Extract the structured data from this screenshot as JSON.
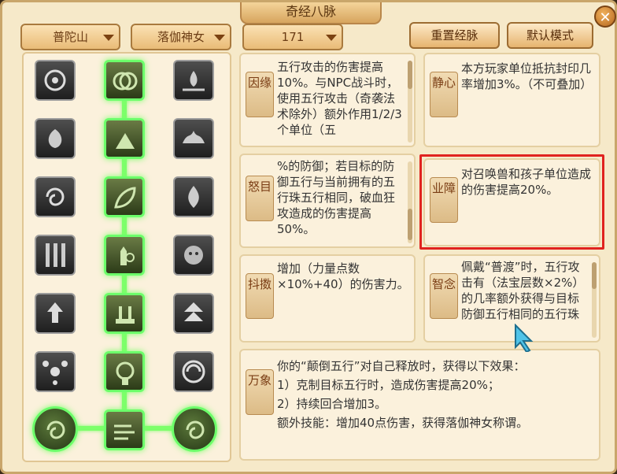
{
  "window": {
    "title": "奇经八脉",
    "close_icon": "close-icon"
  },
  "toolbar": {
    "school": "普陀山",
    "faction": "落伽神女",
    "level": "171",
    "reset_label": "重置经脉",
    "default_label": "默认模式"
  },
  "tree": {
    "left_icons": [
      "lotus-icon",
      "lotus-bud-icon",
      "swirl-icon",
      "bamboo-icon",
      "arrow-up-icon",
      "molecule-icon"
    ],
    "center_icons": [
      "rings-icon",
      "pouring-icon",
      "leaf-icon",
      "hand-sign-icon",
      "temple-icon",
      "bodhisattva-icon"
    ],
    "right_icons": [
      "water-lotus-icon",
      "blooming-lotus-icon",
      "flame-icon",
      "lion-icon",
      "double-arrow-icon",
      "vortex-icon"
    ],
    "bottom_nodes": [
      "spiral-node-left-icon",
      "wind-node-center-icon",
      "spiral-node-right-icon"
    ]
  },
  "cards": {
    "yinyuan": {
      "label": "因缘",
      "text": "五行攻击的伤害提高10%。与NPC战斗时，使用五行攻击（奇袭法术除外）额外作用1/2/3个单位（五"
    },
    "jingxin": {
      "label": "静心",
      "text": "本方玩家单位抵抗封印几率增加3%。（不可叠加）"
    },
    "numu": {
      "label": "怒目",
      "text": "%的防御；若目标的防御五行与当前拥有的五行珠五行相同，破血狂攻造成的伤害提高50%。"
    },
    "yezhang": {
      "label": "业障",
      "text": "对召唤兽和孩子单位造成的伤害提高20%。"
    },
    "dousou": {
      "label": "抖擞",
      "text": "增加（力量点数×10%+40）的伤害力。"
    },
    "zhinian": {
      "label": "智念",
      "text": "佩戴“普渡”时，五行攻击有（法宝层数×2%）的几率额外获得与目标防御五行相同的五行珠"
    },
    "wanxiang": {
      "label": "万象",
      "lines": [
        "你的“颠倒五行”对自己释放时，获得以下效果：",
        "1）克制目标五行时，造成伤害提高20%；",
        "2）持续回合增加3。",
        "额外技能：增加40点伤害，获得落伽神女称谓。"
      ]
    }
  },
  "colors": {
    "active_glow": "#6cff6a",
    "highlight_border": "#e0221f",
    "panel_bg": "#f6e9c9"
  }
}
